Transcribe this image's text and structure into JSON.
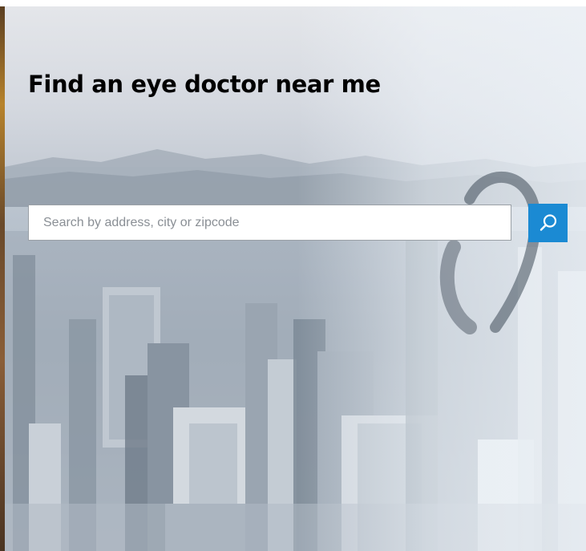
{
  "hero": {
    "title": "Find an eye doctor near me"
  },
  "search": {
    "placeholder": "Search by address, city or zipcode",
    "value": "",
    "button_icon": "search-icon"
  },
  "colors": {
    "accent": "#1b8ad3",
    "title": "#000000",
    "placeholder": "#8a8f95"
  }
}
